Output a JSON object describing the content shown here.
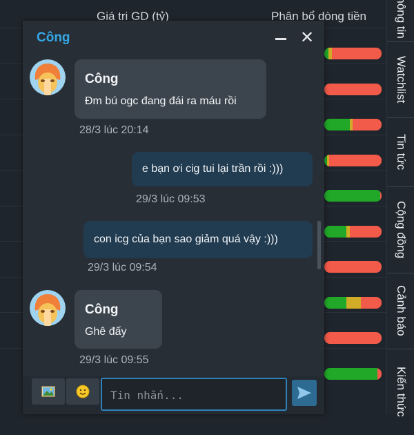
{
  "background": {
    "columns": [
      "Giá trị GD (tỷ)",
      "Phân bổ dòng tiền"
    ],
    "flow_rows": [
      [
        0.07,
        0.06,
        0.87
      ],
      [
        0,
        0,
        1
      ],
      [
        0.45,
        0.05,
        0.5
      ],
      [
        0.05,
        0.03,
        0.92
      ],
      [
        0.97,
        0,
        0.03
      ],
      [
        0.38,
        0.06,
        0.56
      ],
      [
        0,
        0,
        1
      ],
      [
        0.38,
        0.26,
        0.36
      ],
      [
        0,
        0,
        1
      ],
      [
        0.93,
        0,
        0.07
      ]
    ],
    "colors": {
      "buy": "#21a829",
      "neutral": "#d1ac26",
      "sell": "#f25a4a"
    }
  },
  "right_tabs": [
    "Thông tin",
    "Watchlist",
    "Tin tức",
    "Cộng đồng",
    "Cảnh báo",
    "Kiến thức"
  ],
  "chat": {
    "title": "Công",
    "messages": [
      {
        "sender": "Công",
        "text": "Đm bú ogc đang đái ra máu rồi",
        "time": "28/3 lúc 20:14"
      },
      {
        "text": "e bạn ơi cig tui lại trần rồi :)))",
        "time": "29/3 lúc 09:53"
      },
      {
        "text": "con icg của bạn sao giảm quá vậy :)))",
        "time": "29/3 lúc 09:54"
      },
      {
        "sender": "Công",
        "text": "Ghê đấy",
        "time": "29/3 lúc 09:55"
      }
    ],
    "input_placeholder": "Tin nhắn...",
    "colors": {
      "accent": "#35a7e6",
      "incoming": "#3c454e",
      "outgoing": "#213b50"
    }
  }
}
